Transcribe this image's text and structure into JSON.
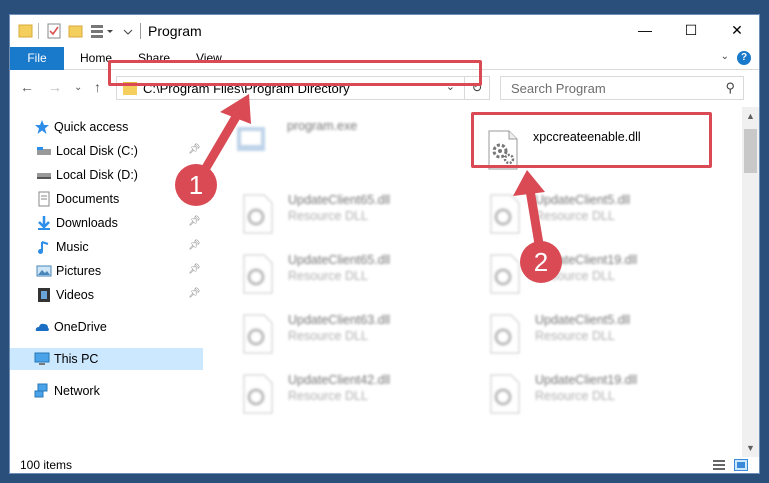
{
  "window": {
    "title": "Program",
    "minimize_label": "—",
    "maximize_label": "☐",
    "close_label": "✕"
  },
  "ribbon": {
    "tabs": [
      "File",
      "Home",
      "Share",
      "View"
    ],
    "help_label": "?"
  },
  "navigation": {
    "address_path": "C:\\Program Files\\Program Directory",
    "search_placeholder": "Search Program"
  },
  "sidebar": {
    "items": [
      {
        "label": "Quick access",
        "icon": "star-icon"
      },
      {
        "label": "Local Disk (C:)",
        "icon": "drive-icon",
        "pinned": true
      },
      {
        "label": "Local Disk (D:)",
        "icon": "drive-icon",
        "pinned": false
      },
      {
        "label": "Documents",
        "icon": "documents-icon",
        "pinned": true
      },
      {
        "label": "Downloads",
        "icon": "downloads-icon",
        "pinned": true
      },
      {
        "label": "Music",
        "icon": "music-icon",
        "pinned": true
      },
      {
        "label": "Pictures",
        "icon": "pictures-icon",
        "pinned": true
      },
      {
        "label": "Videos",
        "icon": "videos-icon",
        "pinned": true
      },
      {
        "label": "OneDrive",
        "icon": "onedrive-icon"
      },
      {
        "label": "This PC",
        "icon": "this-pc-icon",
        "selected": true
      },
      {
        "label": "Network",
        "icon": "network-icon"
      }
    ]
  },
  "files": {
    "highlighted": {
      "name": "xpccreateenable.dll"
    },
    "blurred": [
      {
        "name": "program.exe",
        "type": ""
      },
      {
        "name": "UpdateClient65.dll",
        "type": "Resource DLL"
      },
      {
        "name": "UpdateClient5.dll",
        "type": "Resource DLL"
      },
      {
        "name": "UpdateClient65.dll",
        "type": "Resource DLL"
      },
      {
        "name": "UpdateClient19.dll",
        "type": "Resource DLL"
      },
      {
        "name": "UpdateClient63.dll",
        "type": "Resource DLL"
      },
      {
        "name": "UpdateClient5.dll",
        "type": "Resource DLL"
      },
      {
        "name": "UpdateClient42.dll",
        "type": "Resource DLL"
      },
      {
        "name": "UpdateClient19.dll",
        "type": "Resource DLL"
      }
    ]
  },
  "status": {
    "item_count": "100 items"
  },
  "annotations": {
    "step1": "1",
    "step2": "2",
    "color": "#d94a54"
  }
}
